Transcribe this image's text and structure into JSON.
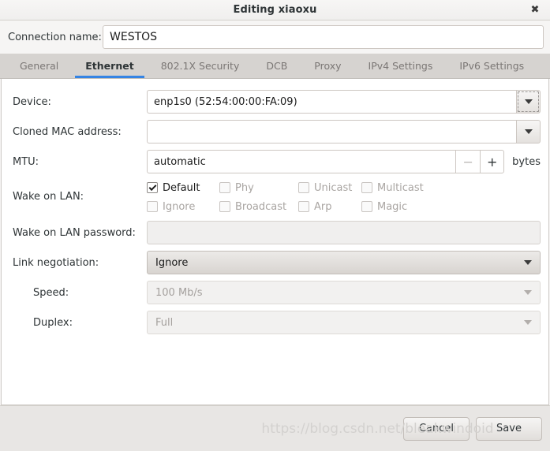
{
  "window": {
    "title": "Editing xiaoxu",
    "close_icon": "close-icon"
  },
  "connection": {
    "label": "Connection name:",
    "value": "WESTOS",
    "placeholder": ""
  },
  "tabs": [
    {
      "label": "General",
      "active": false
    },
    {
      "label": "Ethernet",
      "active": true
    },
    {
      "label": "802.1X Security",
      "active": false
    },
    {
      "label": "DCB",
      "active": false
    },
    {
      "label": "Proxy",
      "active": false
    },
    {
      "label": "IPv4 Settings",
      "active": false
    },
    {
      "label": "IPv6 Settings",
      "active": false
    }
  ],
  "form": {
    "device": {
      "label": "Device:",
      "value": "enp1s0 (52:54:00:00:FA:09)"
    },
    "cloned_mac": {
      "label": "Cloned MAC address:",
      "value": "",
      "placeholder": ""
    },
    "mtu": {
      "label": "MTU:",
      "value": "automatic",
      "minus_label": "−",
      "plus_label": "+",
      "unit": "bytes"
    },
    "wake_on_lan": {
      "label": "Wake on LAN:",
      "options": [
        {
          "label": "Default",
          "checked": true,
          "enabled": true
        },
        {
          "label": "Phy",
          "checked": false,
          "enabled": false
        },
        {
          "label": "Unicast",
          "checked": false,
          "enabled": false
        },
        {
          "label": "Multicast",
          "checked": false,
          "enabled": false
        },
        {
          "label": "Ignore",
          "checked": false,
          "enabled": false
        },
        {
          "label": "Broadcast",
          "checked": false,
          "enabled": false
        },
        {
          "label": "Arp",
          "checked": false,
          "enabled": false
        },
        {
          "label": "Magic",
          "checked": false,
          "enabled": false
        }
      ]
    },
    "wol_password": {
      "label": "Wake on LAN password:",
      "value": "",
      "placeholder": ""
    },
    "link_negotiation": {
      "label": "Link negotiation:",
      "value": "Ignore",
      "enabled": true
    },
    "speed": {
      "label": "Speed:",
      "value": "100 Mb/s",
      "enabled": false
    },
    "duplex": {
      "label": "Duplex:",
      "value": "Full",
      "enabled": false
    }
  },
  "footer": {
    "cancel_label": "Cancel",
    "save_label": "Save",
    "watermark": "https://blog.csdn.net/bleakwindoid"
  },
  "colors": {
    "accent": "#3584e4",
    "tabbar_bg": "#d6d3d0",
    "panel_bg": "#ffffff",
    "footer_bg": "#e8e6e4"
  }
}
